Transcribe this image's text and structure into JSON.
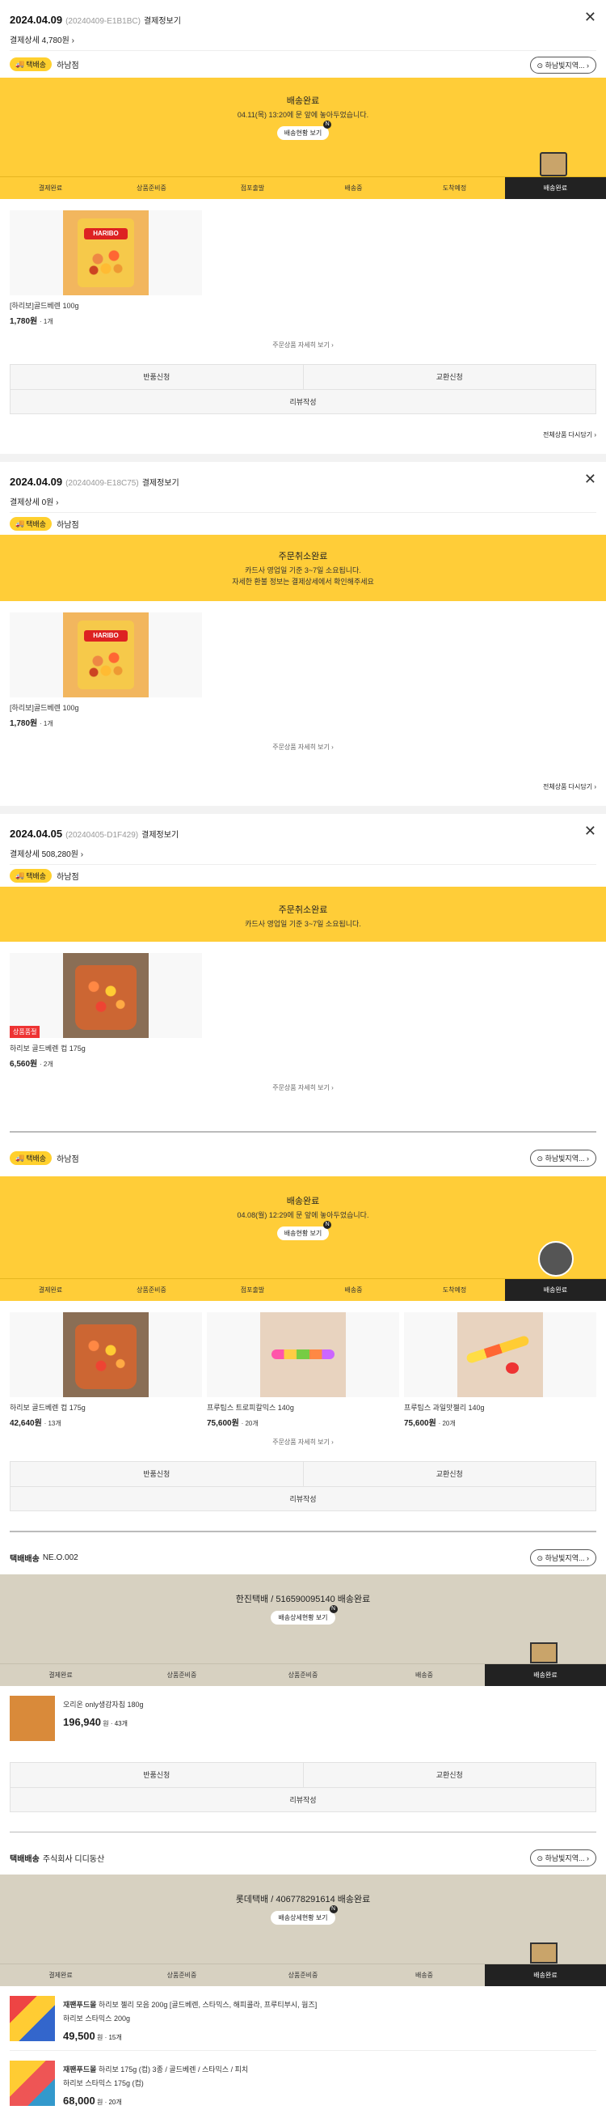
{
  "orders": [
    {
      "date": "2024.04.09",
      "number": "(20240409-E1B1BC)",
      "detail_label": "결제정보기",
      "pay": "결제상세 4,780원 ›",
      "badge": "택배송",
      "store": "하남점",
      "loc_btn": "하남빛지역...",
      "banner_title": "배송완료",
      "banner_sub": "04.11(목) 13:20에 문 앞에 놓아두었습니다.",
      "banner_btn": "배송현황 보기",
      "steps": [
        "결제완료",
        "상품준비중",
        "점포출발",
        "배송중",
        "도착예정",
        "배송완료"
      ],
      "product": {
        "name": "[하리보]골드베렌 100g",
        "price": "1,780원",
        "qty": "1개"
      },
      "more": "주문상품 자세히 보기 ›",
      "actions": [
        "반품신청",
        "교환신청"
      ],
      "review": "리뷰작성",
      "rebuy": "전체상품 다시담기 ›"
    },
    {
      "date": "2024.04.09",
      "number": "(20240409-E18C75)",
      "detail_label": "결제정보기",
      "pay": "결제상세 0원 ›",
      "badge": "택배송",
      "store": "하남점",
      "banner_title": "주문취소완료",
      "banner_sub1": "카드사 영업일 기준 3~7일 소요됩니다.",
      "banner_sub2": "자세한 환불 정보는 결제상세에서 확인해주세요",
      "product": {
        "name": "[하리보]골드베렌 100g",
        "price": "1,780원",
        "qty": "1개"
      },
      "more": "주문상품 자세히 보기 ›",
      "rebuy": "전체상품 다시담기 ›"
    },
    {
      "date": "2024.04.05",
      "number": "(20240405-D1F429)",
      "detail_label": "결제정보기",
      "pay": "결제상세 508,280원 ›",
      "badge": "택배송",
      "store": "하남점",
      "banner_title": "주문취소완료",
      "banner_sub": "카드사 영업일 기준 3~7일 소요됩니다.",
      "product": {
        "tag": "상품품절",
        "name": "하리보 골드베렌 컵 175g",
        "price": "6,560원",
        "qty": "2개"
      },
      "more": "주문상품 자세히 보기 ›",
      "group2": {
        "badge": "택배송",
        "store": "하남점",
        "loc_btn": "하남빛지역...",
        "banner_title": "배송완료",
        "banner_sub": "04.08(월) 12:29에 문 앞에 놓아두었습니다.",
        "banner_btn": "배송현황 보기",
        "steps": [
          "결제완료",
          "상품준비중",
          "점포출발",
          "배송중",
          "도착예정",
          "배송완료"
        ],
        "products": [
          {
            "name": "하리보 골드베렌 컵 175g",
            "price": "42,640원",
            "qty": "13개"
          },
          {
            "name": "프루팁스 트로피칼믹스 140g",
            "price": "75,600원",
            "qty": "20개"
          },
          {
            "name": "프루팁스 과일맛젤리 140g",
            "price": "75,600원",
            "qty": "20개"
          }
        ],
        "more": "주문상품 자세히 보기 ›",
        "actions": [
          "반품신청",
          "교환신청"
        ],
        "review": "리뷰작성"
      },
      "group3": {
        "seller": "택배배송",
        "seller_sub": "NE.O.002",
        "loc_btn": "하남빛지역...",
        "banner_title": "한진택배 / 516590095140 배송완료",
        "banner_btn": "배송상세현황 보기",
        "steps": [
          "결제완료",
          "상품준비중",
          "상품준비중",
          "배송중",
          "배송완료"
        ],
        "item": {
          "name": "오리온 only생감자칩 180g",
          "price": "196,940",
          "unit": "원",
          "qty": "43개"
        },
        "actions": [
          "반품신청",
          "교환신청"
        ],
        "review": "리뷰작성"
      },
      "group4": {
        "seller": "택배배송",
        "seller_sub": "주식회사 디디동산",
        "loc_btn": "하남빛지역...",
        "banner_title": "롯데택배 / 406778291614 배송완료",
        "banner_btn": "배송상세현황 보기",
        "steps": [
          "결제완료",
          "상품준비중",
          "상품준비중",
          "배송중",
          "배송완료"
        ],
        "items": [
          {
            "brand": "재팬푸드몰",
            "name": "하리보 젤리 모음 200g [골드베렌, 스타믹스, 해피콜라, 프루티부시, 웜즈]",
            "option": "하리보 스타믹스 200g",
            "price": "49,500",
            "unit": "원",
            "qty": "15개"
          },
          {
            "brand": "재팬푸드몰",
            "name": "하리보 175g (컵) 3종 / 골드베렌 / 스타믹스 / 피치",
            "option": "하리보 스타믹스 175g (컵)",
            "price": "68,000",
            "unit": "원",
            "qty": "20개"
          }
        ]
      }
    }
  ]
}
